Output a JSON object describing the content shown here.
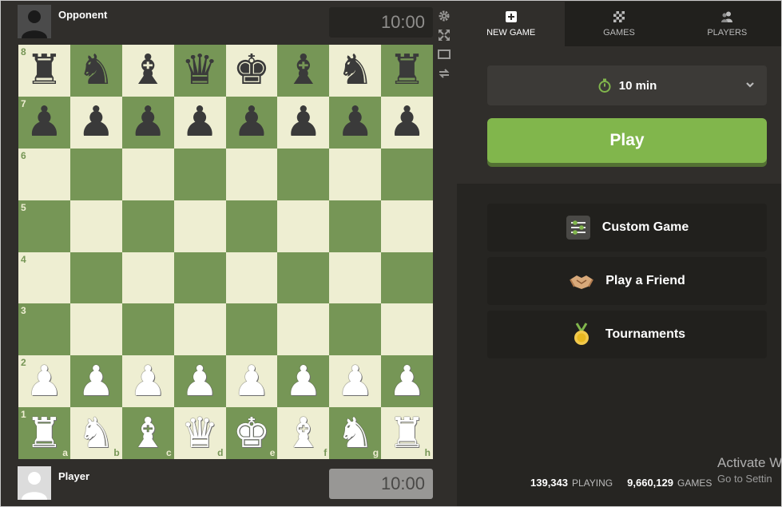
{
  "opponent": {
    "name": "Opponent",
    "clock": "10:00"
  },
  "player": {
    "name": "Player",
    "clock": "10:00"
  },
  "board": {
    "ranks": [
      "8",
      "7",
      "6",
      "5",
      "4",
      "3",
      "2",
      "1"
    ],
    "files": [
      "a",
      "b",
      "c",
      "d",
      "e",
      "f",
      "g",
      "h"
    ],
    "rows": [
      [
        "♜",
        "♞",
        "♝",
        "♛",
        "♚",
        "♝",
        "♞",
        "♜"
      ],
      [
        "♟",
        "♟",
        "♟",
        "♟",
        "♟",
        "♟",
        "♟",
        "♟"
      ],
      [
        "",
        "",
        "",
        "",
        "",
        "",
        "",
        ""
      ],
      [
        "",
        "",
        "",
        "",
        "",
        "",
        "",
        ""
      ],
      [
        "",
        "",
        "",
        "",
        "",
        "",
        "",
        ""
      ],
      [
        "",
        "",
        "",
        "",
        "",
        "",
        "",
        ""
      ],
      [
        "♟",
        "♟",
        "♟",
        "♟",
        "♟",
        "♟",
        "♟",
        "♟"
      ],
      [
        "♜",
        "♞",
        "♝",
        "♛",
        "♚",
        "♝",
        "♞",
        "♜"
      ]
    ],
    "light_color": "#eeeed2",
    "dark_color": "#769656"
  },
  "side_tools": [
    "gear-icon",
    "expand-icon",
    "theater-icon",
    "flip-icon"
  ],
  "tabs": [
    {
      "label": "NEW GAME",
      "icon": "plus-square-icon",
      "active": true
    },
    {
      "label": "GAMES",
      "icon": "checkerboard-icon",
      "active": false
    },
    {
      "label": "PLAYERS",
      "icon": "players-icon",
      "active": false
    }
  ],
  "time_control": {
    "value": "10 min",
    "icon": "stopwatch-icon"
  },
  "play_label": "Play",
  "menu": [
    {
      "label": "Custom Game",
      "icon": "sliders-icon"
    },
    {
      "label": "Play a Friend",
      "icon": "handshake-icon"
    },
    {
      "label": "Tournaments",
      "icon": "medal-icon"
    }
  ],
  "stats": {
    "playing_count": "139,343",
    "playing_label": "PLAYING",
    "games_count": "9,660,129",
    "games_label": "GAMES"
  },
  "watermark": {
    "line1": "Activate W",
    "line2": "Go to Settin"
  },
  "colors": {
    "accent": "#81b64c",
    "panel": "#262522",
    "background": "#302e2b"
  }
}
